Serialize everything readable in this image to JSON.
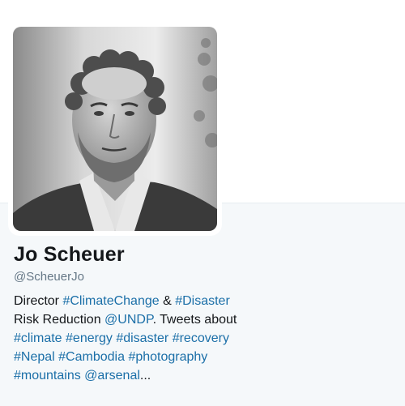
{
  "profile": {
    "name": "Jo Scheuer",
    "handle": "@ScheuerJo",
    "bio": {
      "line1": [
        {
          "text": "Director ",
          "type": "text"
        },
        {
          "text": "#ClimateChange",
          "type": "hashtag"
        },
        {
          "text": " & ",
          "type": "text"
        },
        {
          "text": "#Disaster",
          "type": "hashtag"
        }
      ],
      "line2": [
        {
          "text": "Risk Reduction ",
          "type": "text"
        },
        {
          "text": "@UNDP",
          "type": "mention"
        },
        {
          "text": ". Tweets about",
          "type": "text"
        }
      ],
      "line3": [
        {
          "text": "#climate",
          "type": "hashtag"
        },
        {
          "text": " ",
          "type": "text"
        },
        {
          "text": "#energy",
          "type": "hashtag"
        },
        {
          "text": " ",
          "type": "text"
        },
        {
          "text": "#disaster",
          "type": "hashtag"
        },
        {
          "text": " ",
          "type": "text"
        },
        {
          "text": "#recovery",
          "type": "hashtag"
        }
      ],
      "line4": [
        {
          "text": "#Nepal",
          "type": "hashtag"
        },
        {
          "text": " ",
          "type": "text"
        },
        {
          "text": "#Cambodia",
          "type": "hashtag"
        },
        {
          "text": " ",
          "type": "text"
        },
        {
          "text": "#photography",
          "type": "hashtag"
        }
      ],
      "line5": [
        {
          "text": "#mountains",
          "type": "hashtag"
        },
        {
          "text": " ",
          "type": "text"
        },
        {
          "text": "@arsenal",
          "type": "mention"
        },
        {
          "text": "...",
          "type": "text"
        }
      ]
    }
  },
  "colors": {
    "link": "#1b6fa8",
    "name": "#14171a",
    "handle": "#657786",
    "lower_background": "#f5f8fa"
  }
}
